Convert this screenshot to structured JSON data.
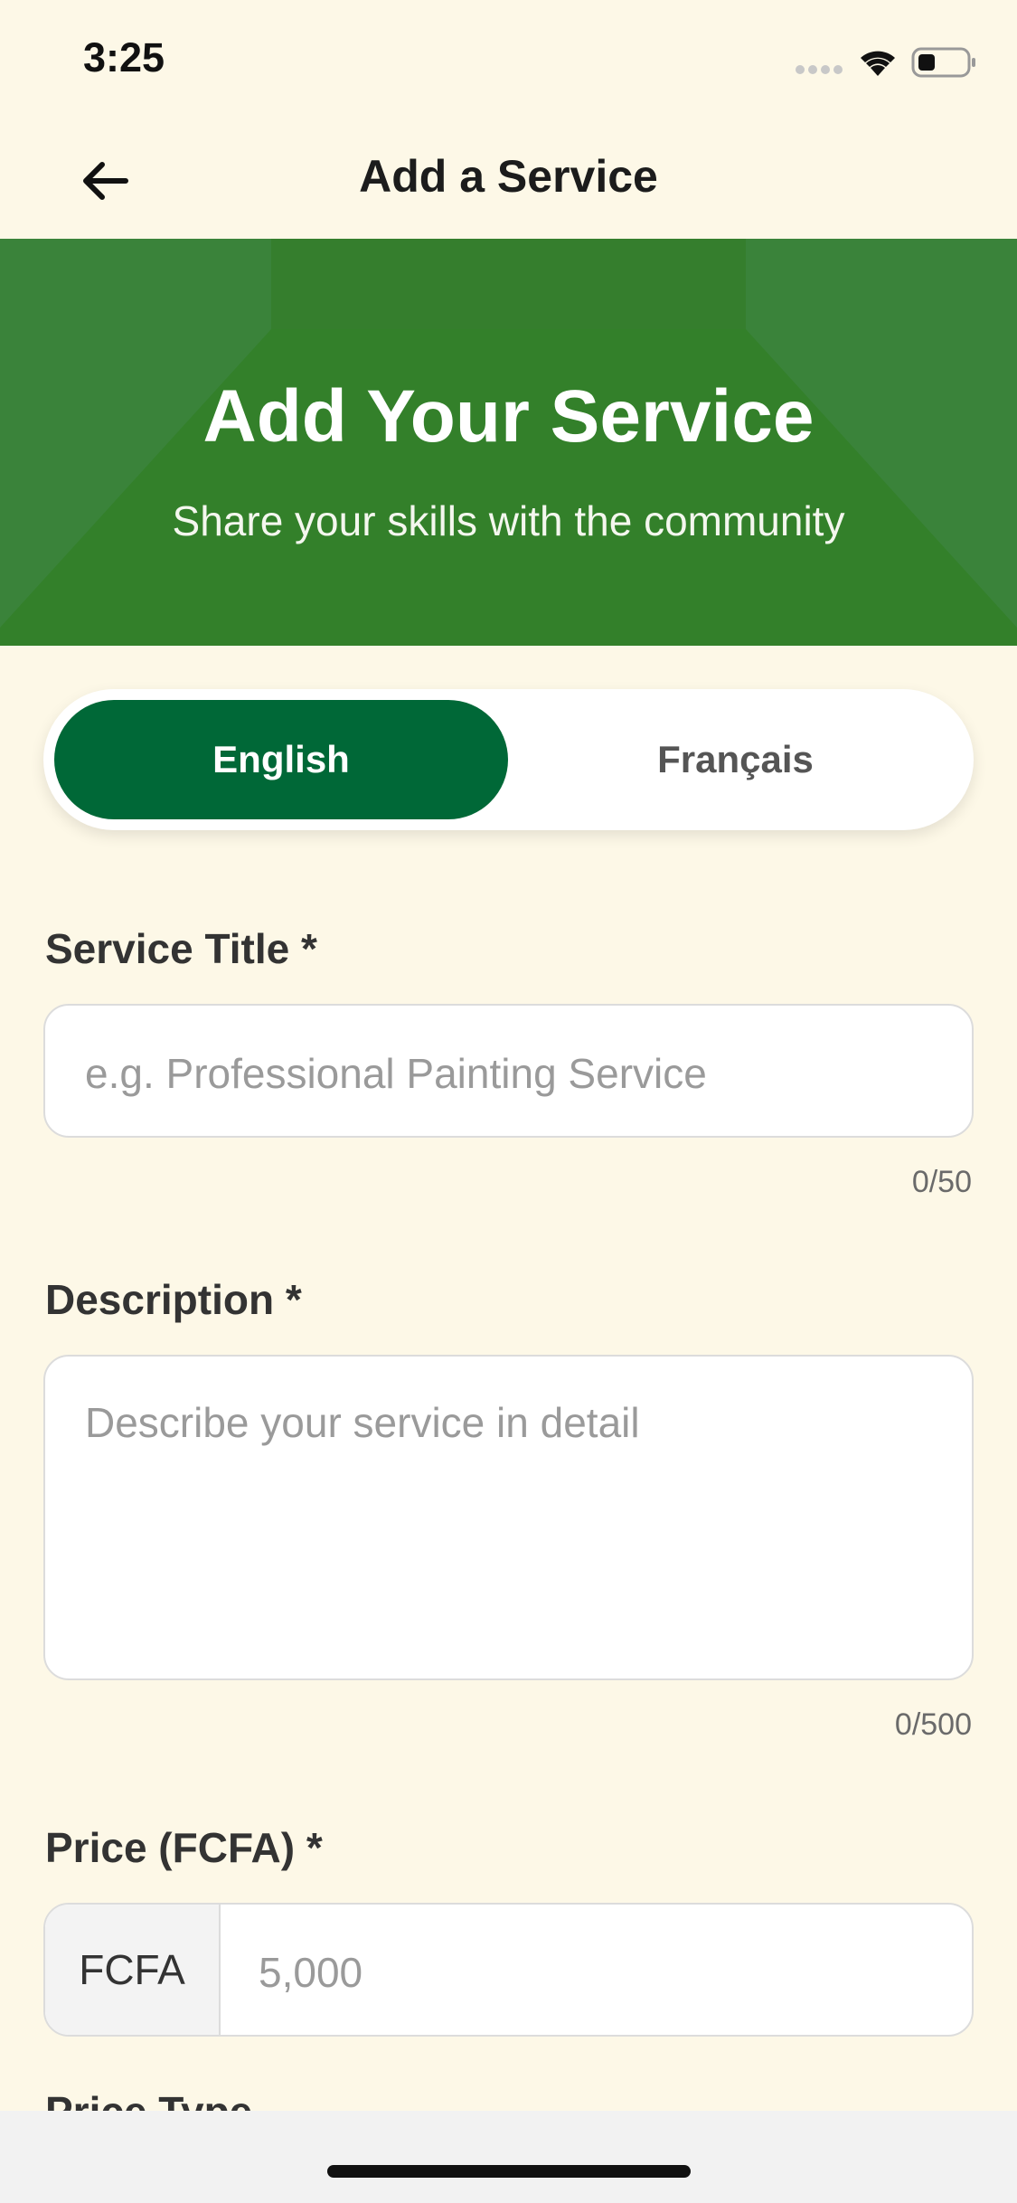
{
  "status_bar": {
    "time": "3:25"
  },
  "nav": {
    "title": "Add a Service"
  },
  "hero": {
    "title": "Add Your Service",
    "subtitle": "Share your skills with the community",
    "color": "#37802E"
  },
  "language_toggle": {
    "options": [
      "English",
      "Français"
    ],
    "selected": "English",
    "accent_color": "#006837"
  },
  "form": {
    "service_title": {
      "label": "Service Title *",
      "placeholder": "e.g. Professional Painting Service",
      "value": "",
      "counter": "0/50"
    },
    "description": {
      "label": "Description *",
      "placeholder": "Describe your service in detail",
      "value": "",
      "counter": "0/500"
    },
    "price": {
      "label": "Price (FCFA) *",
      "currency": "FCFA",
      "placeholder": "5,000",
      "value": ""
    },
    "price_type": {
      "label": "Price Type"
    }
  },
  "icons": {
    "back": "arrow-left-icon",
    "signal": "signal-icon",
    "wifi": "wifi-icon",
    "battery": "battery-icon"
  },
  "colors": {
    "background": "#FDF8E7"
  }
}
